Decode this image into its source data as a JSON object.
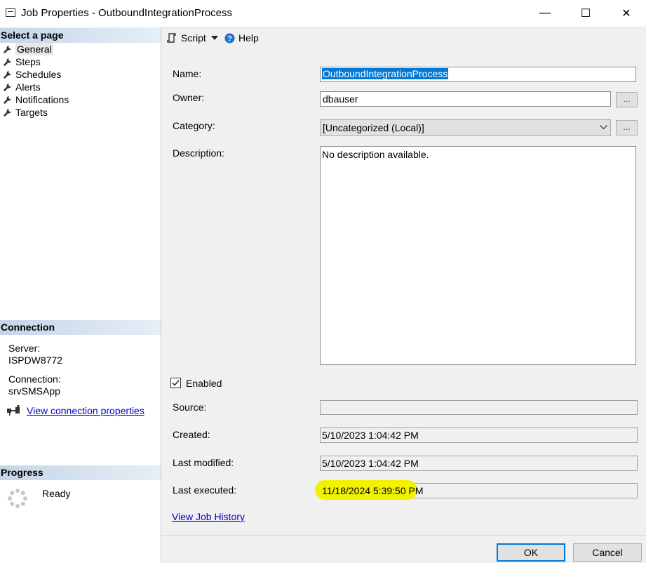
{
  "window": {
    "title": "Job Properties - OutboundIntegrationProcess",
    "minimize_glyph": "—",
    "maximize_glyph": "☐",
    "close_glyph": "✕"
  },
  "left": {
    "select_page_header": "Select a page",
    "pages": [
      {
        "label": "General",
        "icon": "wrench-icon"
      },
      {
        "label": "Steps",
        "icon": "wrench-icon"
      },
      {
        "label": "Schedules",
        "icon": "wrench-icon"
      },
      {
        "label": "Alerts",
        "icon": "wrench-icon"
      },
      {
        "label": "Notifications",
        "icon": "wrench-icon"
      },
      {
        "label": "Targets",
        "icon": "wrench-icon"
      }
    ],
    "connection_header": "Connection",
    "server_label": "Server:",
    "server_value": "ISPDW8772",
    "connection_label": "Connection:",
    "connection_value": "srvSMSApp",
    "view_connection_link": "View connection properties",
    "progress_header": "Progress",
    "progress_status": "Ready"
  },
  "toolbar": {
    "script_label": "Script",
    "help_label": "Help"
  },
  "form": {
    "name_label": "Name:",
    "name_value": "OutboundIntegrationProcess",
    "owner_label": "Owner:",
    "owner_value": "dbauser",
    "category_label": "Category:",
    "category_value": "[Uncategorized (Local)]",
    "description_label": "Description:",
    "description_value": "No description available.",
    "browse_label": "...",
    "enabled_label": "Enabled",
    "enabled_checked": true,
    "source_label": "Source:",
    "source_value": "",
    "created_label": "Created:",
    "created_value": "5/10/2023 1:04:42 PM",
    "last_modified_label": "Last modified:",
    "last_modified_value": "5/10/2023 1:04:42 PM",
    "last_executed_label": "Last executed:",
    "last_executed_value": "11/18/2024 5:39:50 PM",
    "view_history_link": "View Job History"
  },
  "buttons": {
    "ok_label": "OK",
    "cancel_label": "Cancel"
  },
  "colors": {
    "section_header": "#c5d5e8",
    "highlight": "#f2f200",
    "selection": "#0078d7",
    "link": "#0000cc"
  }
}
